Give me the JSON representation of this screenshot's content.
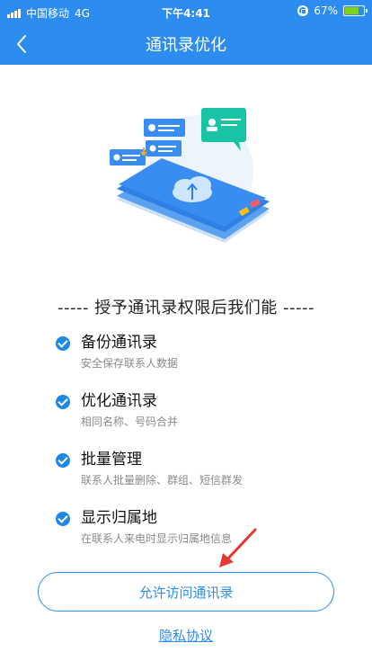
{
  "status_bar": {
    "carrier": "中国移动",
    "network": "4G",
    "time": "下午4:41",
    "battery_percent": "67%",
    "battery_level": 0.67
  },
  "nav": {
    "title": "通讯录优化",
    "back_icon": "chevron-left-icon"
  },
  "heading": "----- 授予通讯录权限后我们能 -----",
  "features": [
    {
      "title": "备份通讯录",
      "subtitle": "安全保存联系人数据"
    },
    {
      "title": "优化通讯录",
      "subtitle": "相同名称、号码合并"
    },
    {
      "title": "批量管理",
      "subtitle": "联系人批量删除、群组、短信群发"
    },
    {
      "title": "显示归属地",
      "subtitle": "在联系人来电时显示归属地信息"
    }
  ],
  "actions": {
    "primary": "允许访问通讯录",
    "privacy": "隐私协议"
  },
  "colors": {
    "primary": "#2d8cf0",
    "check": "#1e88e5",
    "arrow": "#e53935"
  }
}
